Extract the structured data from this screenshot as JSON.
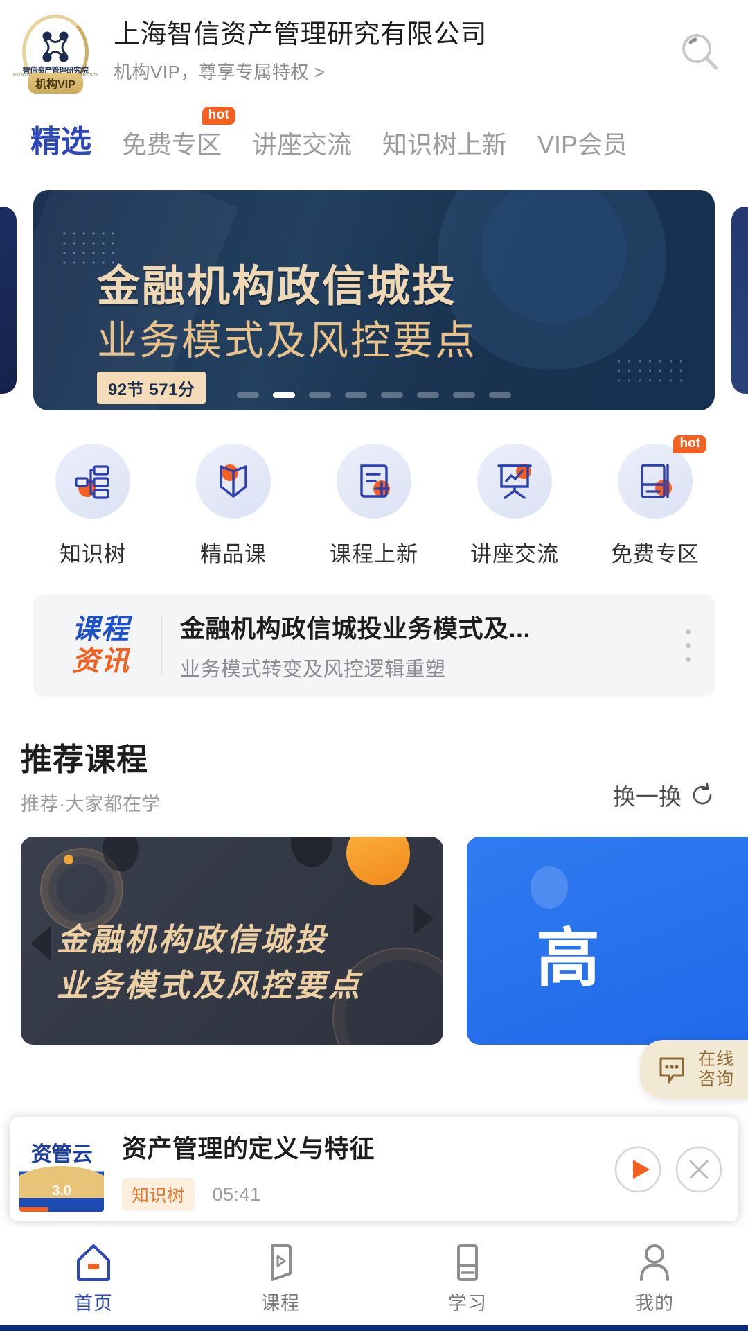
{
  "header": {
    "org_name": "上海智信资产管理研究有限公司",
    "vip_line": "机构VIP，尊享专属特权 >",
    "logo_cn": "智信资产管理研究院",
    "logo_en": "ZHIXIN ASSET MANAGEMENT RESEARCH INSTITUTE",
    "logo_badge": "机构VIP",
    "search_icon": "search-icon"
  },
  "tabs": [
    {
      "label": "精选",
      "active": true,
      "hot": ""
    },
    {
      "label": "免费专区",
      "active": false,
      "hot": "hot"
    },
    {
      "label": "讲座交流",
      "active": false,
      "hot": ""
    },
    {
      "label": "知识树上新",
      "active": false,
      "hot": ""
    },
    {
      "label": "VIP会员",
      "active": false,
      "hot": ""
    }
  ],
  "banner": {
    "line1": "金融机构政信城投",
    "line2": "业务模式及风控要点",
    "badge": "92节 571分",
    "dots_total": 8,
    "dots_active_index": 1
  },
  "quick_entries": [
    {
      "label": "知识树",
      "icon": "knowledge-tree-icon",
      "hot": ""
    },
    {
      "label": "精品课",
      "icon": "open-book-icon",
      "hot": ""
    },
    {
      "label": "课程上新",
      "icon": "add-document-icon",
      "hot": ""
    },
    {
      "label": "讲座交流",
      "icon": "presentation-icon",
      "hot": ""
    },
    {
      "label": "免费专区",
      "icon": "free-book-icon",
      "hot": "hot"
    }
  ],
  "news": {
    "logo_top": "课程",
    "logo_bottom": "资讯",
    "title": "金融机构政信城投业务模式及...",
    "subtitle": "业务模式转变及风控逻辑重塑",
    "more_icon": "more-vertical-icon"
  },
  "recommend": {
    "title": "推荐课程",
    "subtitle": "推荐·大家都在学",
    "refresh_label": "换一换",
    "refresh_icon": "refresh-icon",
    "cards": [
      {
        "style": "dark",
        "line1": "金融机构政信城投",
        "line2": "业务模式及风控要点"
      },
      {
        "style": "blue",
        "big": "高"
      }
    ]
  },
  "chat_fab": {
    "line1": "在线",
    "line2": "咨询",
    "icon": "chat-bubble-icon"
  },
  "player": {
    "thumb_title": "资管云",
    "thumb_version": "3.0",
    "title": "资产管理的定义与特征",
    "tag": "知识树",
    "time": "05:41",
    "play_icon": "play-icon",
    "close_icon": "close-icon"
  },
  "bottom_nav": [
    {
      "label": "首页",
      "icon": "home-icon",
      "active": true
    },
    {
      "label": "课程",
      "icon": "course-icon",
      "active": false
    },
    {
      "label": "学习",
      "icon": "study-icon",
      "active": false
    },
    {
      "label": "我的",
      "icon": "profile-icon",
      "active": false
    }
  ],
  "colors": {
    "accent_blue": "#2b47b8",
    "accent_orange": "#f4601f",
    "gold": "#cbab5d",
    "banner_navy": "#1b3152"
  }
}
